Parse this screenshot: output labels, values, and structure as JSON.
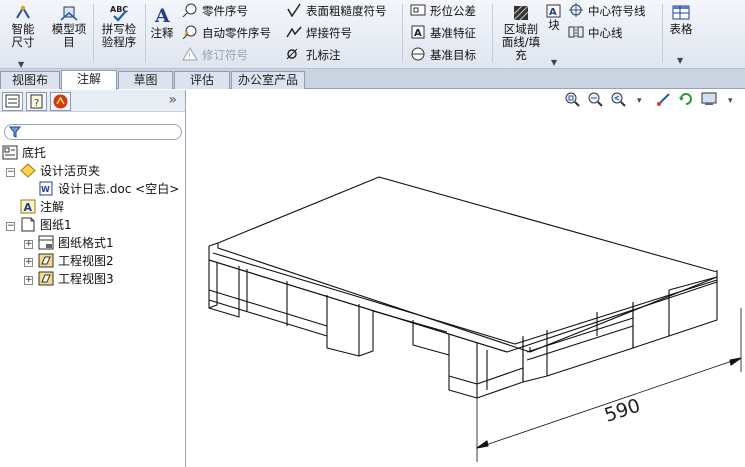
{
  "ribbon": {
    "smart_dimension": "智能尺寸",
    "model_items": "模型项目",
    "spell_check": "拼写检验程序",
    "abc_badge": "ABC",
    "note": "注释",
    "balloon": "零件序号",
    "auto_balloon": "自动零件序号",
    "revision_symbol": "修订符号",
    "surface_finish": "表面粗糙度符号",
    "weld_symbol": "焊接符号",
    "hole_callout": "孔标注",
    "geometric_tolerance": "形位公差",
    "datum_feature": "基准特征",
    "datum_target": "基准目标",
    "area_hatch": "区域剖面线/填充",
    "block": "块",
    "center_mark": "中心符号线",
    "centerline": "中心线",
    "tables": "表格"
  },
  "tabs": [
    "视图布局",
    "注解",
    "草图",
    "评估",
    "办公室产品"
  ],
  "active_tab": "注解",
  "tree": {
    "root": "底托",
    "design_binder": "设计活页夹",
    "design_log": "设计日志.doc <空白>",
    "annotations": "注解",
    "sheet": "图纸1",
    "sheet_format": "图纸格式1",
    "drawing_view2": "工程视图2",
    "drawing_view3": "工程视图3"
  },
  "panel": {
    "chevron": "»"
  },
  "drawing": {
    "dimension_value": "590"
  },
  "colors": {
    "ribbon_bg": "#dfe5ef",
    "tab_bar": "#c9d3e2",
    "accent_blue": "#1f5fb0"
  }
}
